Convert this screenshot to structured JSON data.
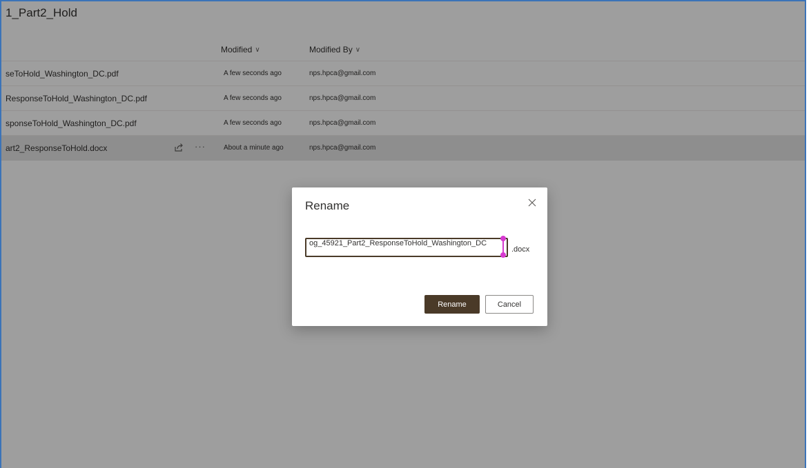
{
  "folder": {
    "title": "1_Part2_Hold"
  },
  "columns": {
    "modified": "Modified",
    "modified_by": "Modified By"
  },
  "files": [
    {
      "name": "seToHold_Washington_DC.pdf",
      "modified": "A few seconds ago",
      "modified_by": "nps.hpca@gmail.com"
    },
    {
      "name": "ResponseToHold_Washington_DC.pdf",
      "modified": "A few seconds ago",
      "modified_by": "nps.hpca@gmail.com"
    },
    {
      "name": "sponseToHold_Washington_DC.pdf",
      "modified": "A few seconds ago",
      "modified_by": "nps.hpca@gmail.com"
    },
    {
      "name": "art2_ResponseToHold.docx",
      "modified": "About a minute ago",
      "modified_by": "nps.hpca@gmail.com",
      "selected": true
    }
  ],
  "row_actions": {
    "more": "···"
  },
  "dialog": {
    "title": "Rename",
    "input_value": "og_45921_Part2_ResponseToHold_Washington_DC",
    "extension": ".docx",
    "rename_label": "Rename",
    "cancel_label": "Cancel"
  },
  "colors": {
    "accent": "#4a3a28",
    "frame_border": "#3b73b8",
    "selection_handle": "#d63ad0"
  }
}
